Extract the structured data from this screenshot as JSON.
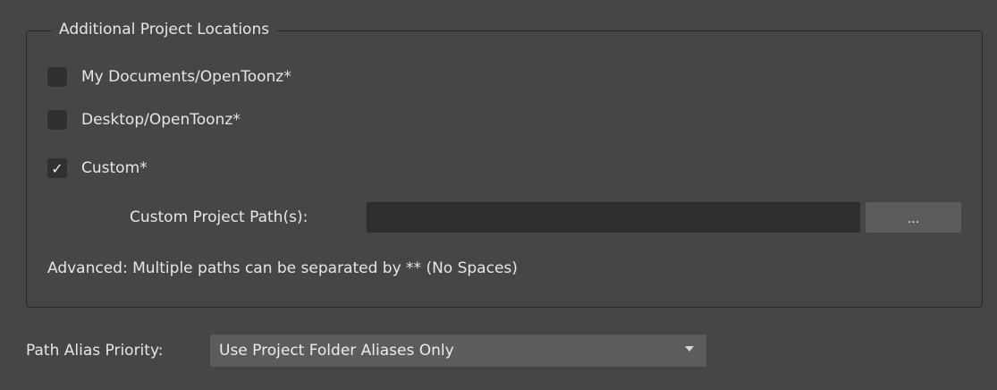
{
  "group": {
    "title": "Additional Project Locations",
    "options": [
      {
        "label": "My Documents/OpenToonz*",
        "checked": false
      },
      {
        "label": "Desktop/OpenToonz*",
        "checked": false
      },
      {
        "label": "Custom*",
        "checked": true
      }
    ],
    "check_mark": "✓",
    "custom_path": {
      "label": "Custom Project Path(s):",
      "value": "",
      "browse_label": "..."
    },
    "hint": "Advanced: Multiple paths can be separated by ** (No Spaces)"
  },
  "alias_priority": {
    "label": "Path Alias Priority:",
    "selected": "Use Project Folder Aliases Only"
  }
}
